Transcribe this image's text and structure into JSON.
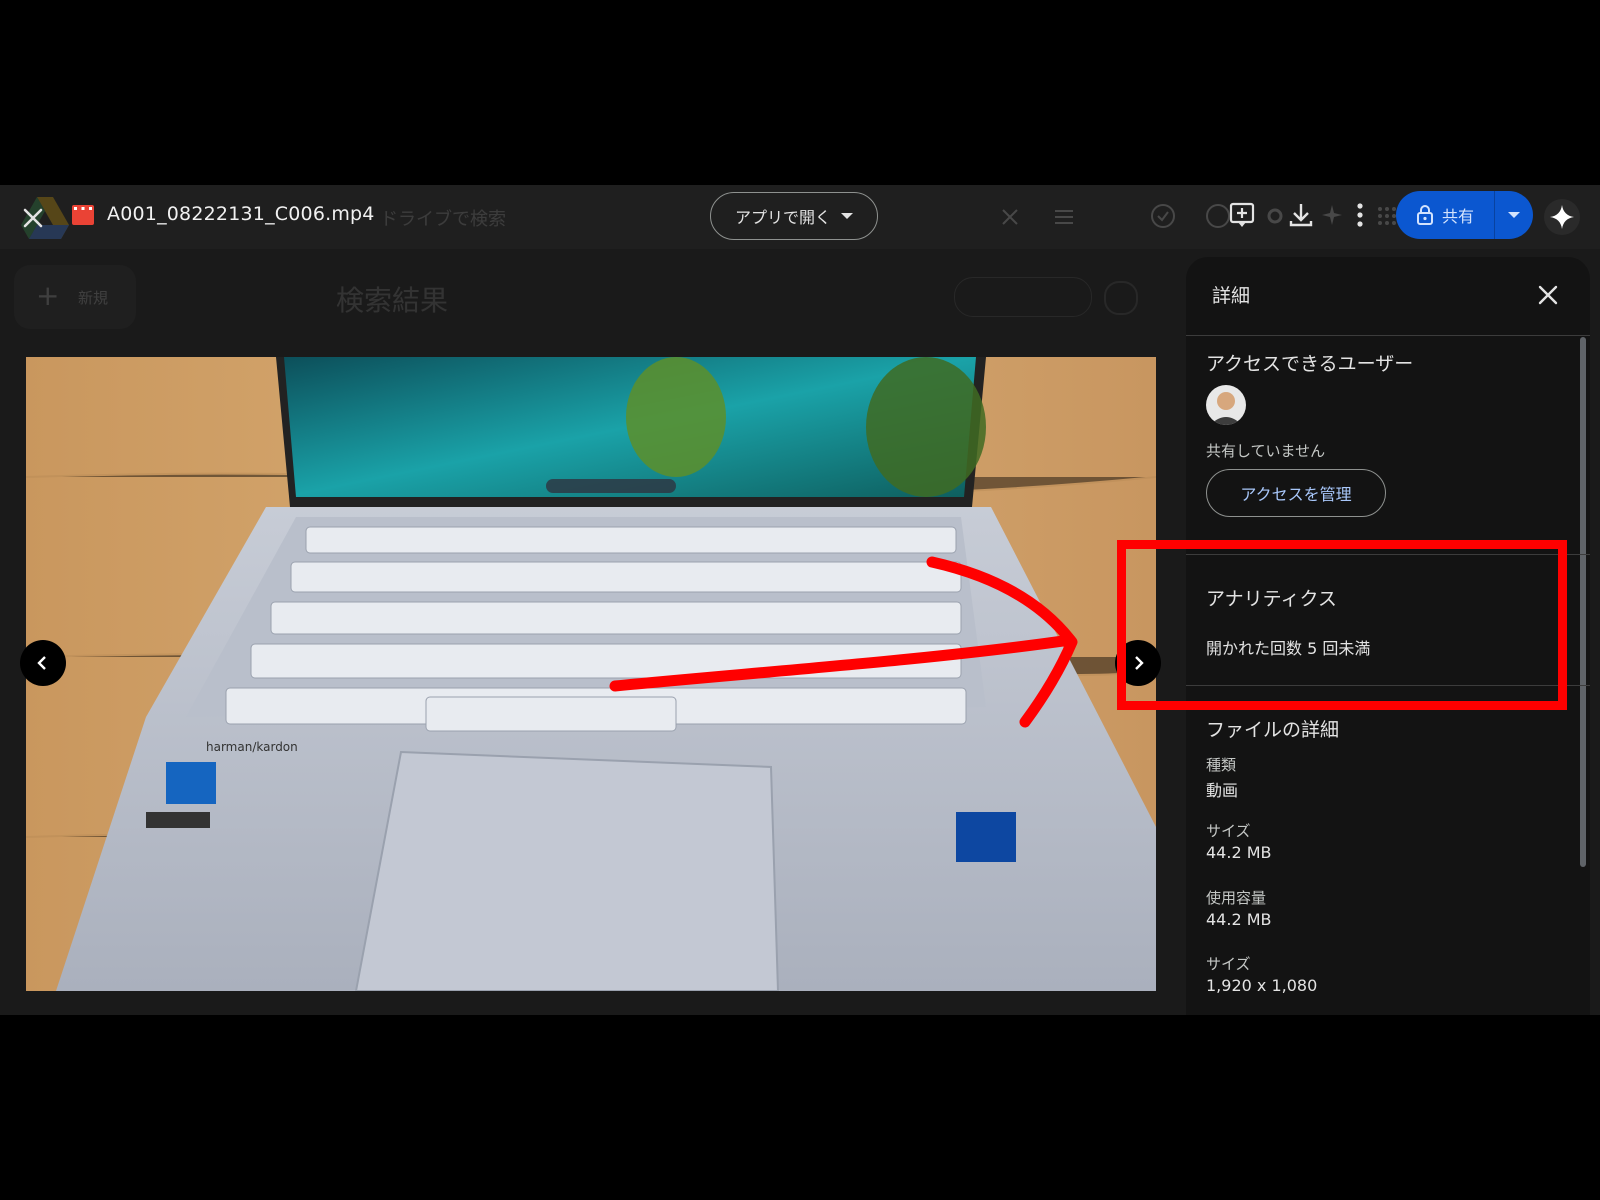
{
  "topbar": {
    "file_name": "A001_08222131_C006.mp4",
    "search_placeholder": "ドライブで検索",
    "open_with_label": "アプリで開く",
    "share_label": "共有"
  },
  "background": {
    "new_label": "新規",
    "page_title": "検索結果"
  },
  "details": {
    "title": "詳細",
    "access_heading": "アクセスできるユーザー",
    "sharing_status": "共有していません",
    "manage_access_label": "アクセスを管理",
    "analytics_heading": "アナリティクス",
    "analytics_text": "開かれた回数 5 回未満",
    "file_details_heading": "ファイルの詳細",
    "fields": [
      {
        "label": "種類",
        "value": "動画"
      },
      {
        "label": "サイズ",
        "value": "44.2 MB"
      },
      {
        "label": "使用容量",
        "value": "44.2 MB"
      },
      {
        "label": "サイズ",
        "value": "1,920 x 1,080"
      }
    ]
  },
  "colors": {
    "accent": "#0b57d0",
    "highlight": "#ff0000",
    "panel_bg": "#131313"
  }
}
